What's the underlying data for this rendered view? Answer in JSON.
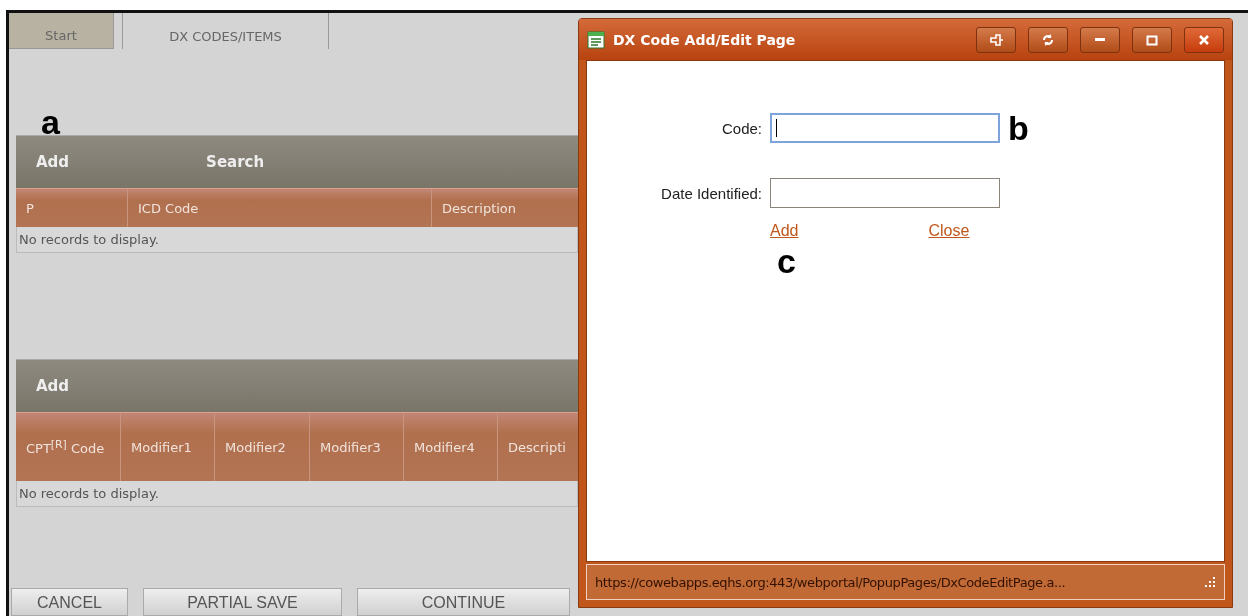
{
  "tabs": [
    {
      "label": "Start",
      "selected": false
    },
    {
      "label": "DX CODES/ITEMS",
      "selected": true
    }
  ],
  "dx_grid": {
    "marker": "a",
    "toolbar": [
      "Add",
      "Search"
    ],
    "columns": [
      "P",
      "ICD Code",
      "Description"
    ],
    "empty_text": "No records to display."
  },
  "cpt_grid": {
    "toolbar": [
      "Add"
    ],
    "columns": [
      "CPT$^{[R]}$ Code",
      "Modifier1",
      "Modifier2",
      "Modifier3",
      "Modifier4",
      "Descripti"
    ],
    "empty_text": "No records to display."
  },
  "footer_buttons": [
    "CANCEL",
    "PARTIAL SAVE",
    "CONTINUE"
  ],
  "dialog": {
    "title": "DX Code Add/Edit Page",
    "fields": [
      {
        "label": "Code:",
        "focused": true,
        "marker": "b"
      },
      {
        "label": "Date Identified:",
        "focused": false
      }
    ],
    "links": [
      "Add",
      "Close"
    ],
    "links_marker": "c",
    "status_url": "https://cowebapps.eqhs.org:443/webportal/PopupPages/DxCodeEditPage.a..."
  }
}
